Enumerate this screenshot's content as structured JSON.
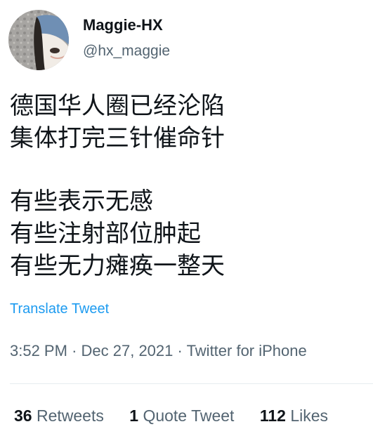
{
  "author": {
    "display_name": "Maggie-HX",
    "handle": "@hx_maggie"
  },
  "tweet": {
    "lines": [
      "德国华人圈已经沦陷",
      "集体打完三针催命针",
      "",
      "有些表示无感",
      "有些注射部位肿起",
      "有些无力瘫痪一整天"
    ],
    "translate_label": "Translate Tweet",
    "time": "3:52 PM",
    "date": "Dec 27, 2021",
    "source": "Twitter for iPhone",
    "separator": "·"
  },
  "stats": {
    "retweets_count": "36",
    "retweets_label": "Retweets",
    "quotes_count": "1",
    "quotes_label": "Quote Tweet",
    "likes_count": "112",
    "likes_label": "Likes"
  },
  "colors": {
    "link": "#1d9bf0",
    "secondary_text": "#536471",
    "primary_text": "#0f1419"
  }
}
